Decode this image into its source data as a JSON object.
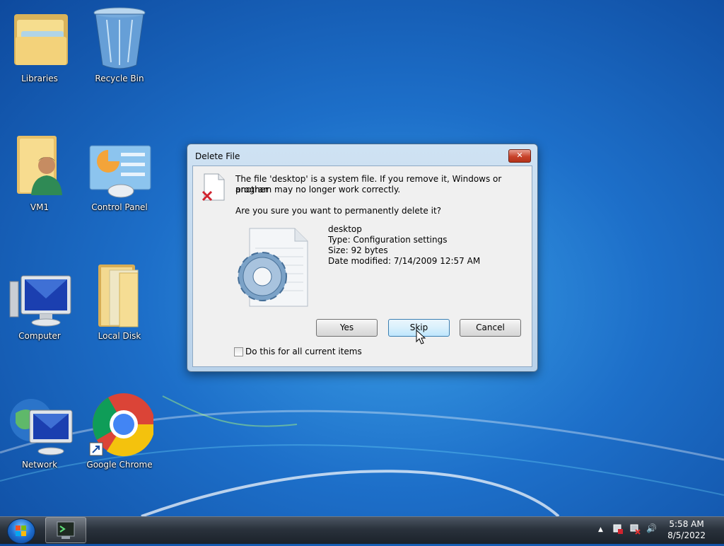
{
  "desktop": {
    "icons": [
      {
        "label": "Libraries"
      },
      {
        "label": "Recycle Bin"
      },
      {
        "label": "VM1"
      },
      {
        "label": "Control Panel"
      },
      {
        "label": "Computer"
      },
      {
        "label": "Local Disk"
      },
      {
        "label": "Network"
      },
      {
        "label": "Google Chrome"
      }
    ]
  },
  "dialog": {
    "title": "Delete File",
    "close_label": "✕",
    "message_line1": "The file 'desktop' is a system file. If you remove it, Windows or another",
    "message_line2": "program may no longer work correctly.",
    "question": "Are you sure you want to permanently delete it?",
    "file": {
      "name": "desktop",
      "type": "Type: Configuration settings",
      "size": "Size: 92 bytes",
      "modified": "Date modified: 7/14/2009 12:57 AM"
    },
    "buttons": {
      "yes": "Yes",
      "skip": "Skip",
      "cancel": "Cancel"
    },
    "checkbox_label": "Do this for all current items",
    "checkbox_checked": false
  },
  "taskbar": {
    "time": "5:58 AM",
    "date": "8/5/2022",
    "tray_arrow": "▲",
    "volume": "🔊"
  }
}
